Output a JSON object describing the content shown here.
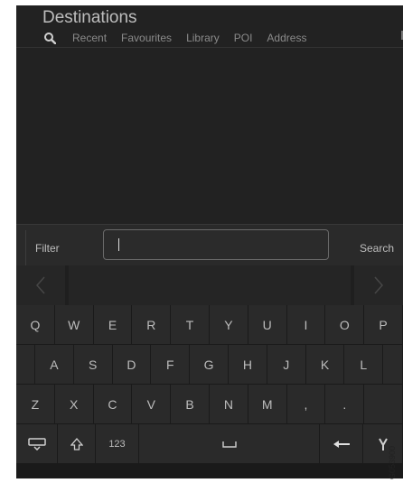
{
  "app": {
    "title": "Destinations"
  },
  "tabs": [
    {
      "label": "Recent"
    },
    {
      "label": "Favourites"
    },
    {
      "label": "Library"
    },
    {
      "label": "POI"
    },
    {
      "label": "Address"
    }
  ],
  "search": {
    "filter_label": "Filter",
    "field_value": "",
    "search_label": "Search"
  },
  "suggestions": {
    "prev_label": "<",
    "next_label": ">"
  },
  "keyboard": {
    "row1": [
      "Q",
      "W",
      "E",
      "R",
      "T",
      "Y",
      "U",
      "I",
      "O",
      "P"
    ],
    "row2": [
      "A",
      "S",
      "D",
      "F",
      "G",
      "H",
      "J",
      "K",
      "L"
    ],
    "row3": [
      "Z",
      "X",
      "C",
      "V",
      "B",
      "N",
      "M",
      ",",
      "."
    ],
    "numbers_label": "123"
  },
  "image_id": "G053900"
}
